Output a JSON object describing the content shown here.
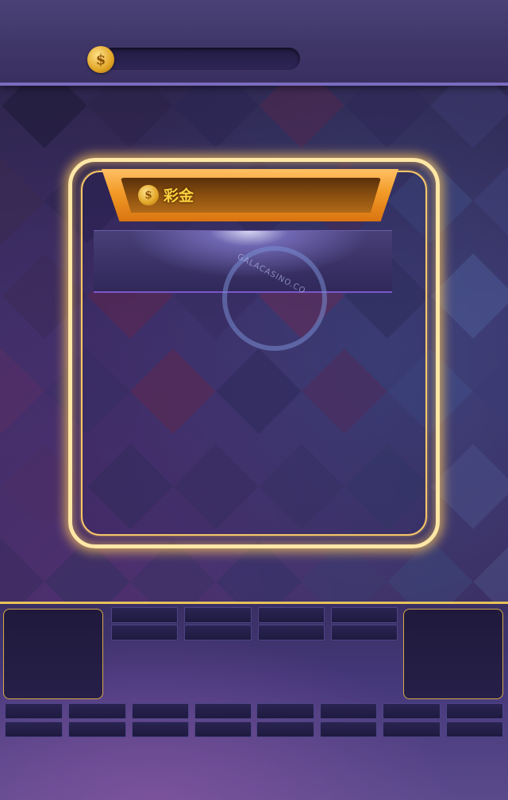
{
  "header": {
    "coin_icon": "dollar-coin-icon",
    "coin_glyph": "$",
    "balance": ""
  },
  "prize_panel": {
    "title": "彩金",
    "coin_icon": "dollar-coin-icon",
    "coin_glyph": "$",
    "promo_watermark": "GALACASINO.CO"
  },
  "colors": {
    "accent_gold": "#ffd23f",
    "panel_glow": "#ffe7a6",
    "banner_orange": "#f29a28",
    "bottom_border": "#e6c25a"
  }
}
